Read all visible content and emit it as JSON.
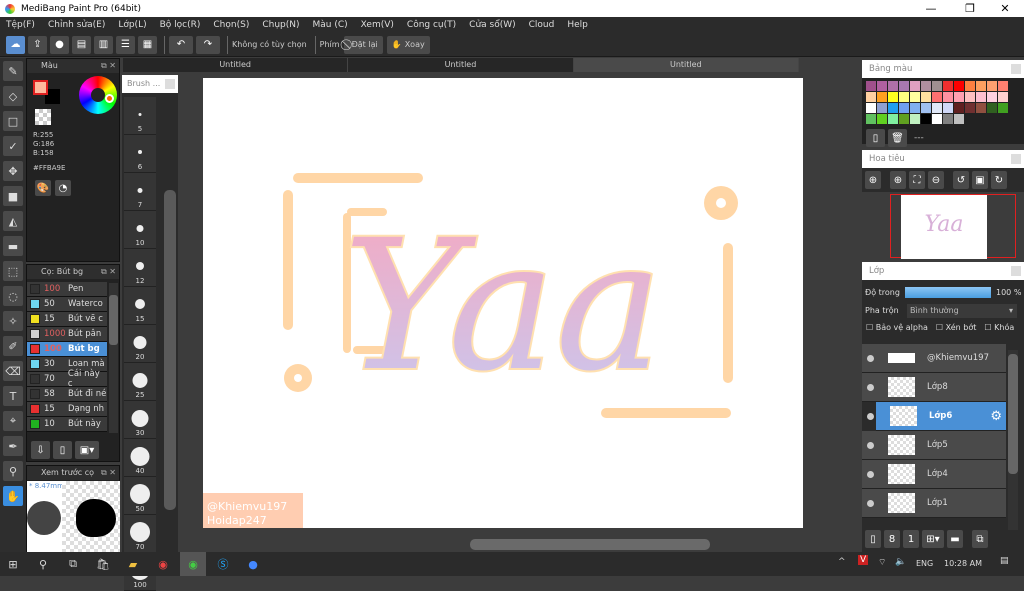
{
  "app": {
    "title": "MediBang Paint Pro (64bit)",
    "min": "—",
    "max": "❐",
    "close": "✕"
  },
  "menu": [
    "Tệp(F)",
    "Chỉnh sửa(E)",
    "Lớp(L)",
    "Bộ lọc(R)",
    "Chọn(S)",
    "Chụp(N)",
    "Màu (C)",
    "Xem(V)",
    "Công cụ(T)",
    "Cửa sổ(W)",
    "Cloud",
    "Help"
  ],
  "toolbar": {
    "no_options": "Không có tùy chọn",
    "key_label": "Phím",
    "reset": "Đặt lại",
    "rotate": "Xoay"
  },
  "tabs": [
    "Untitled",
    "Untitled",
    "Untitled"
  ],
  "color_panel": {
    "title": "Màu",
    "r": "R:255",
    "g": "G:186",
    "b": "B:158",
    "hex": "#FFBA9E",
    "fg": "#FFBA9E",
    "bg": "#000000"
  },
  "brush_panel": {
    "title": "Cọ: Bút bg",
    "items": [
      {
        "size": "100",
        "name": "Pen",
        "color": "#333333",
        "red": true
      },
      {
        "size": "50",
        "name": "Waterco",
        "color": "#6fd6f0"
      },
      {
        "size": "15",
        "name": "Bút vẽ c",
        "color": "#f0e020"
      },
      {
        "size": "1000",
        "name": "Bút pân",
        "color": "#d0d0d0",
        "red": true
      },
      {
        "size": "100",
        "name": "Bút bg",
        "color": "#e83030",
        "red": true,
        "selected": true
      },
      {
        "size": "30",
        "name": "Loan mà",
        "color": "#6fd6f0"
      },
      {
        "size": "70",
        "name": "Cái này c",
        "color": "#333333"
      },
      {
        "size": "58",
        "name": "Bút đi né",
        "color": "#333333"
      },
      {
        "size": "15",
        "name": "Dạng nh",
        "color": "#e83030"
      },
      {
        "size": "10",
        "name": "Bút này",
        "color": "#20b020"
      }
    ]
  },
  "preview": {
    "title": "Xem trước cọ",
    "size": "* 8.47mm"
  },
  "brush_size_panel": {
    "title": "Brush ...",
    "sizes": [
      "5",
      "6",
      "7",
      "10",
      "12",
      "15",
      "20",
      "25",
      "30",
      "40",
      "50",
      "70",
      "100"
    ]
  },
  "canvas": {
    "art_text": "Yaa",
    "watermark1": "@Khiemvu197",
    "watermark2": "Hoidap247"
  },
  "palette_panel": {
    "title": "Bảng màu",
    "set": "---",
    "colors": [
      "#a0508c",
      "#b060a0",
      "#b070a8",
      "#a878b0",
      "#e0a0c0",
      "#b090a0",
      "#a09090",
      "#f03030",
      "#ff0000",
      "#ff8040",
      "#ffa060",
      "#ffa070",
      "#ff8070",
      "#ffd0a0",
      "#ffa020",
      "#ffff20",
      "#ffff80",
      "#ffffa0",
      "#ffe0a0",
      "#ff7070",
      "#ff90a0",
      "#ffa0b0",
      "#ffc0c0",
      "#ffc0d0",
      "#ffd0e0",
      "#ffd0d0",
      "#ffffff",
      "#90a0d0",
      "#20a0f0",
      "#70a0f0",
      "#80b0f0",
      "#a0c0f0",
      "#e0e8f8",
      "#d0d8f8",
      "#602020",
      "#703030",
      "#905040",
      "#306020",
      "#40a020",
      "#60c060",
      "#60d020",
      "#80f0a0",
      "#60a020",
      "#c0f0c0",
      "#000000",
      "#ffffff",
      "#808080",
      "#c0c0c0"
    ]
  },
  "navigator": {
    "title": "Hoa tiêu"
  },
  "layer_panel": {
    "title": "Lớp",
    "opacity_label": "Độ trong",
    "opacity_value": "100 %",
    "opacity": 1.0,
    "blend_label": "Pha trộn",
    "blend_value": "Bình thường",
    "protect_alpha": "Bảo vệ alpha",
    "clip": "Xén bớt",
    "lock": "Khóa",
    "layers": [
      {
        "name": "@Khiemvu197"
      },
      {
        "name": "Lớp8"
      },
      {
        "name": "Lớp6",
        "selected": true
      },
      {
        "name": "Lớp5"
      },
      {
        "name": "Lớp4"
      },
      {
        "name": "Lớp1"
      }
    ]
  },
  "taskbar": {
    "lang": "ENG",
    "time": "10:28 AM"
  }
}
